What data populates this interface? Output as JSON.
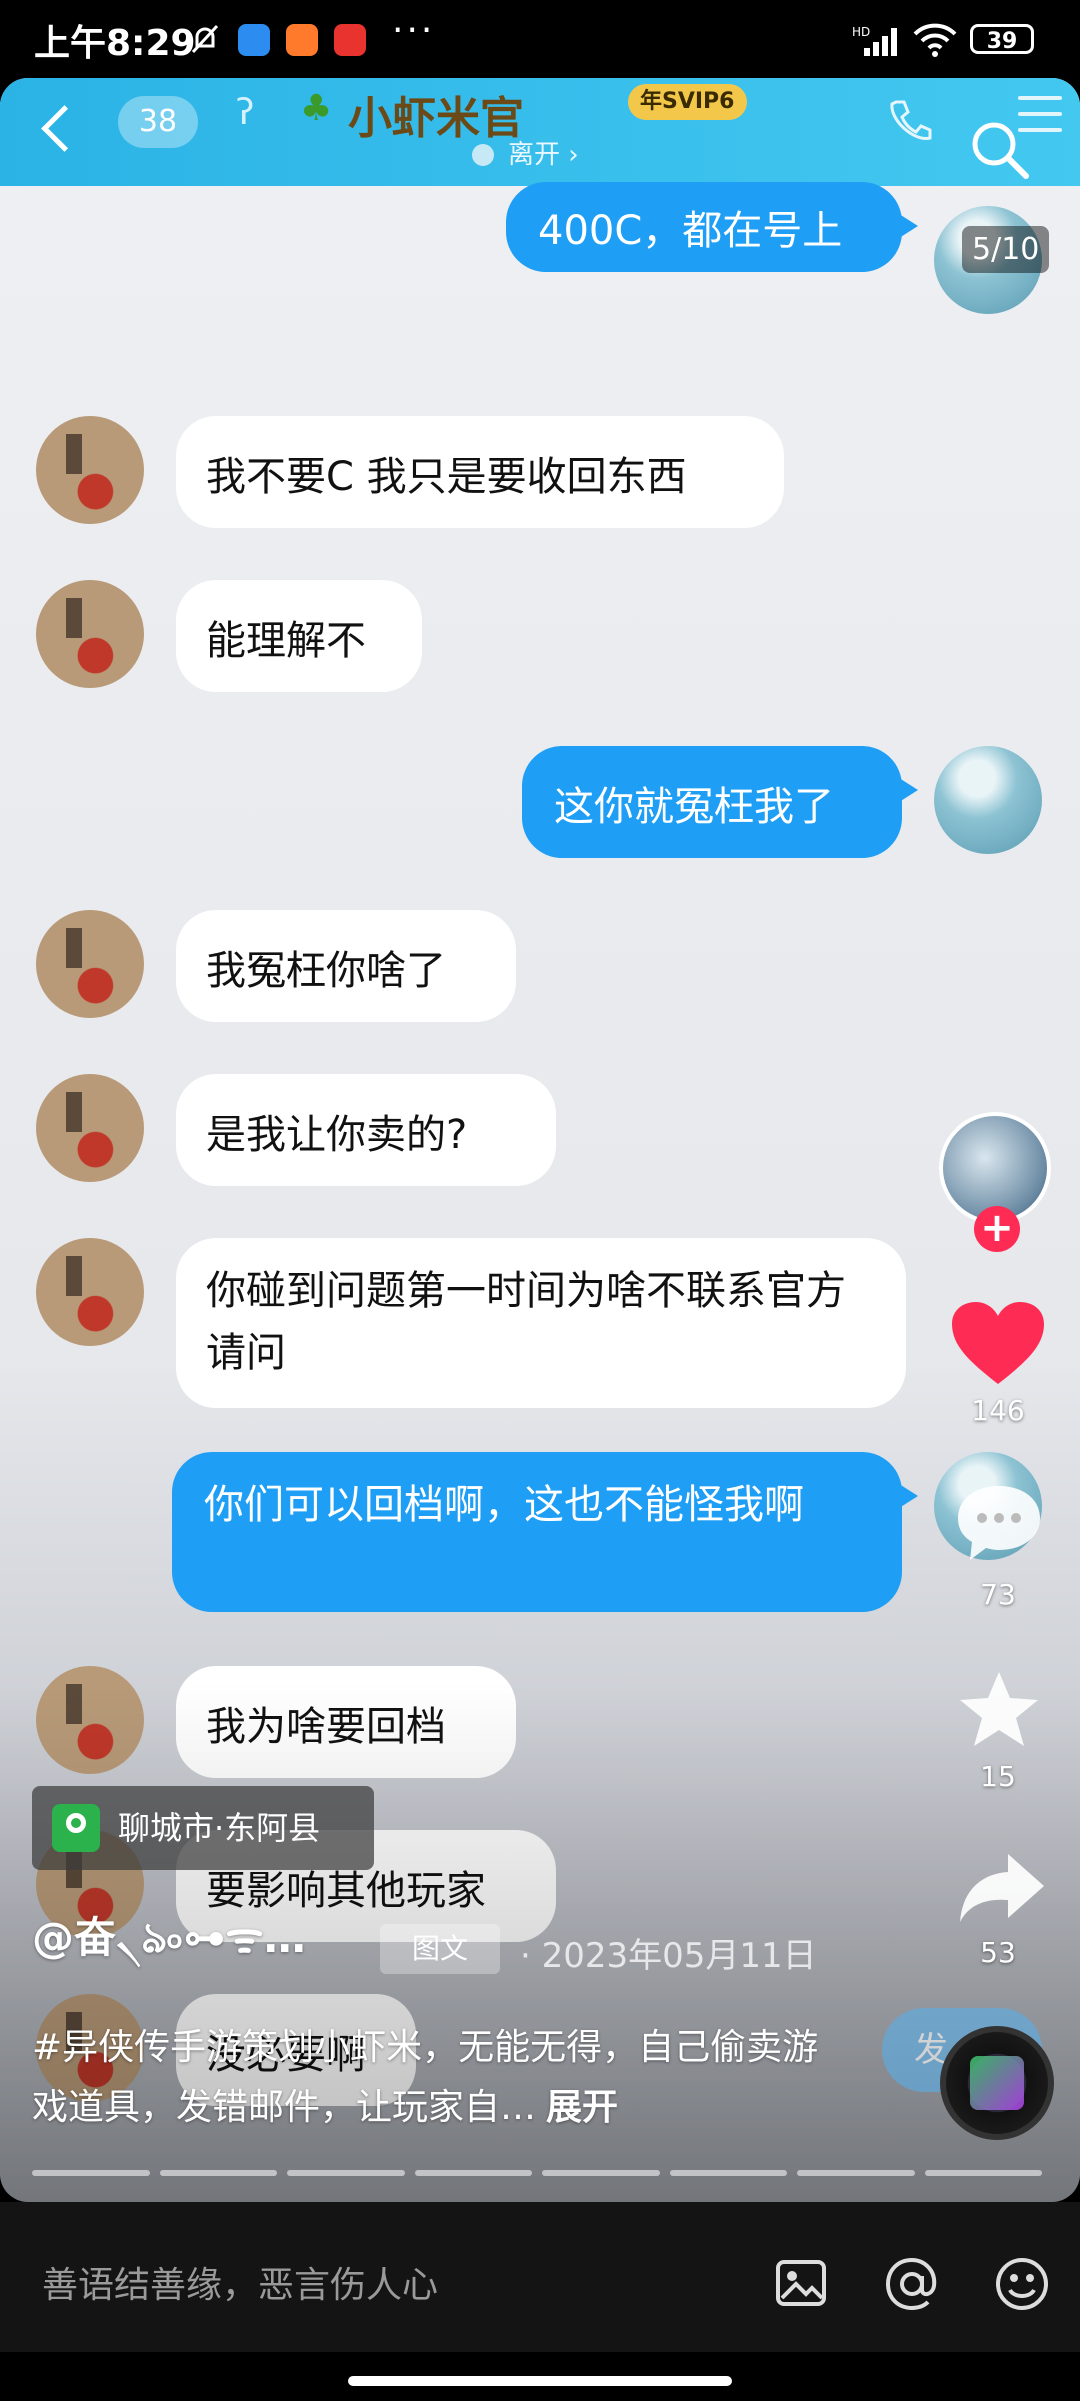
{
  "status_bar": {
    "time": "上午8:29",
    "more": "···",
    "battery": "39",
    "network": "HD"
  },
  "chat_header": {
    "unread_count": "38",
    "contact_name": "小虾米官",
    "vip_badge": "年SVIP6",
    "status": "离开 ›"
  },
  "page_counter": "5/10",
  "messages": [
    {
      "side": "out",
      "text": "400C，都在号上"
    },
    {
      "side": "in",
      "text": "我不要C 我只是要收回东西"
    },
    {
      "side": "in",
      "text": "能理解不"
    },
    {
      "side": "out",
      "text": "这你就冤枉我了"
    },
    {
      "side": "in",
      "text": "我冤枉你啥了"
    },
    {
      "side": "in",
      "text": "是我让你卖的?"
    },
    {
      "side": "in",
      "text": "你碰到问题第一时间为啥不联系官方请问"
    },
    {
      "side": "out",
      "text": "你们可以回档啊，这也不能怪我啊"
    },
    {
      "side": "in",
      "text": "我为啥要回档"
    },
    {
      "side": "in",
      "text": "要影响其他玩家"
    },
    {
      "side": "in",
      "text": "没必要啊"
    }
  ],
  "actions": {
    "likes": "146",
    "comments": "73",
    "favorites": "15",
    "shares": "53"
  },
  "location": "聊城市·东阿县",
  "author": "@奋৲ঌ৹⊶ᯤ…",
  "post_type": "图文",
  "post_date": "· 2023年05月11日",
  "caption": "#异侠传手游策划小虾米，无能无得，自己偷卖游戏道具，发错邮件，让玩家自…",
  "caption_expand": "展开",
  "send_label": "发",
  "comment_placeholder": "善语结善缘，恶言伤人心",
  "colors": {
    "header": "#2bb3e6",
    "bubble_out": "#1e9ef5",
    "like": "#fe2c55"
  }
}
